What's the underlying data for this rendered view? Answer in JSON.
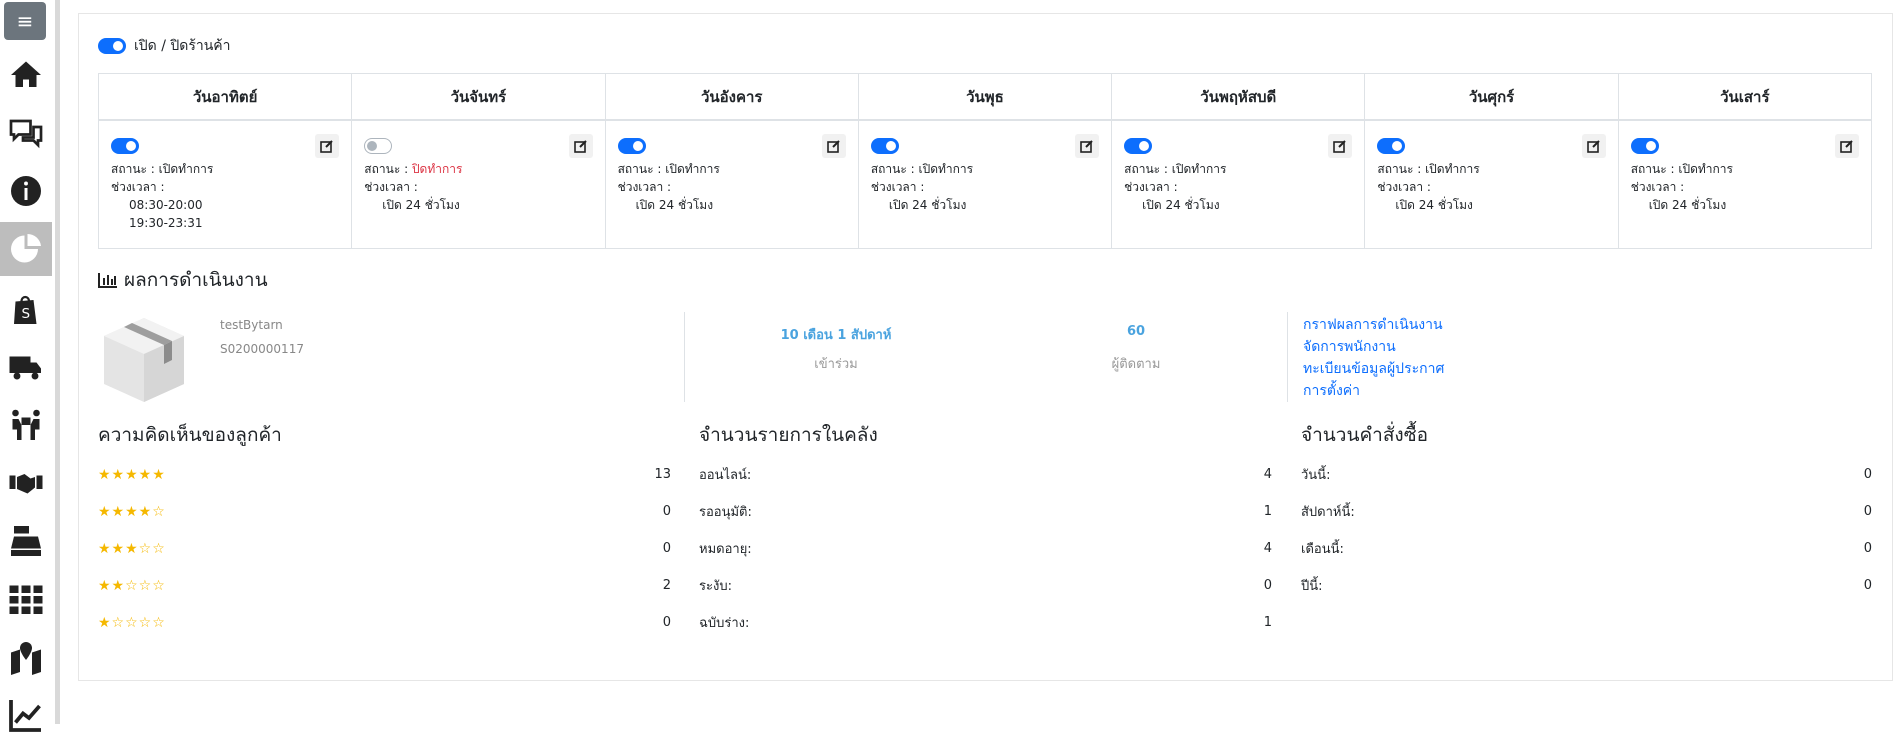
{
  "shop_toggle_label": "เปิด / ปิดร้านค้า",
  "days": [
    {
      "name": "วันอาทิตย์",
      "on": true,
      "status_label": "สถานะ : ",
      "status": "เปิดทำการ",
      "time_label": "ช่วงเวลา :",
      "slots": [
        "08:30-20:00",
        "19:30-23:31"
      ]
    },
    {
      "name": "วันจันทร์",
      "on": false,
      "status_label": "สถานะ : ",
      "status": "ปิดทำการ",
      "time_label": "ช่วงเวลา :",
      "slots": [
        "เปิด 24 ชั่วโมง"
      ]
    },
    {
      "name": "วันอังคาร",
      "on": true,
      "status_label": "สถานะ : ",
      "status": "เปิดทำการ",
      "time_label": "ช่วงเวลา :",
      "slots": [
        "เปิด 24 ชั่วโมง"
      ]
    },
    {
      "name": "วันพุธ",
      "on": true,
      "status_label": "สถานะ : ",
      "status": "เปิดทำการ",
      "time_label": "ช่วงเวลา :",
      "slots": [
        "เปิด 24 ชั่วโมง"
      ]
    },
    {
      "name": "วันพฤหัสบดี",
      "on": true,
      "status_label": "สถานะ : ",
      "status": "เปิดทำการ",
      "time_label": "ช่วงเวลา :",
      "slots": [
        "เปิด 24 ชั่วโมง"
      ]
    },
    {
      "name": "วันศุกร์",
      "on": true,
      "status_label": "สถานะ : ",
      "status": "เปิดทำการ",
      "time_label": "ช่วงเวลา :",
      "slots": [
        "เปิด 24 ชั่วโมง"
      ]
    },
    {
      "name": "วันเสาร์",
      "on": true,
      "status_label": "สถานะ : ",
      "status": "เปิดทำการ",
      "time_label": "ช่วงเวลา :",
      "slots": [
        "เปิด 24 ชั่วโมง"
      ]
    }
  ],
  "performance": {
    "title": "ผลการดำเนินงาน",
    "shop_name": "testBytarn",
    "shop_code": "S0200000117",
    "joined_value": "10 เดือน 1 สัปดาห์",
    "joined_label": "เข้าร่วม",
    "followers_value": "60",
    "followers_label": "ผู้ติดตาม",
    "links": [
      "กราฟผลการดำเนินงาน",
      "จัดการพนักงาน",
      "ทะเบียนข้อมูลผู้ประกาศ",
      "การตั้งค่า"
    ]
  },
  "reviews": {
    "title": "ความคิดเห็นของลูกค้า",
    "rows": [
      {
        "stars": "★★★★★",
        "count": "13"
      },
      {
        "stars": "★★★★☆",
        "count": "0"
      },
      {
        "stars": "★★★☆☆",
        "count": "0"
      },
      {
        "stars": "★★☆☆☆",
        "count": "2"
      },
      {
        "stars": "★☆☆☆☆",
        "count": "0"
      }
    ]
  },
  "inventory": {
    "title": "จำนวนรายการในคลัง",
    "rows": [
      {
        "label": "ออนไลน์:",
        "count": "4"
      },
      {
        "label": "รออนุมัติ:",
        "count": "1"
      },
      {
        "label": "หมดอายุ:",
        "count": "4"
      },
      {
        "label": "ระงับ:",
        "count": "0"
      },
      {
        "label": "ฉบับร่าง:",
        "count": "1"
      }
    ]
  },
  "orders": {
    "title": "จำนวนคำสั่งซื้อ",
    "rows": [
      {
        "label": "วันนี้:",
        "count": "0"
      },
      {
        "label": "สัปดาห์นี้:",
        "count": "0"
      },
      {
        "label": "เดือนนี้:",
        "count": "0"
      },
      {
        "label": "ปีนี้:",
        "count": "0"
      }
    ]
  },
  "colors": {
    "accent": "#0d6efd",
    "closed": "#dc3545",
    "link_light": "#4aa3df",
    "star": "#f5b800"
  }
}
